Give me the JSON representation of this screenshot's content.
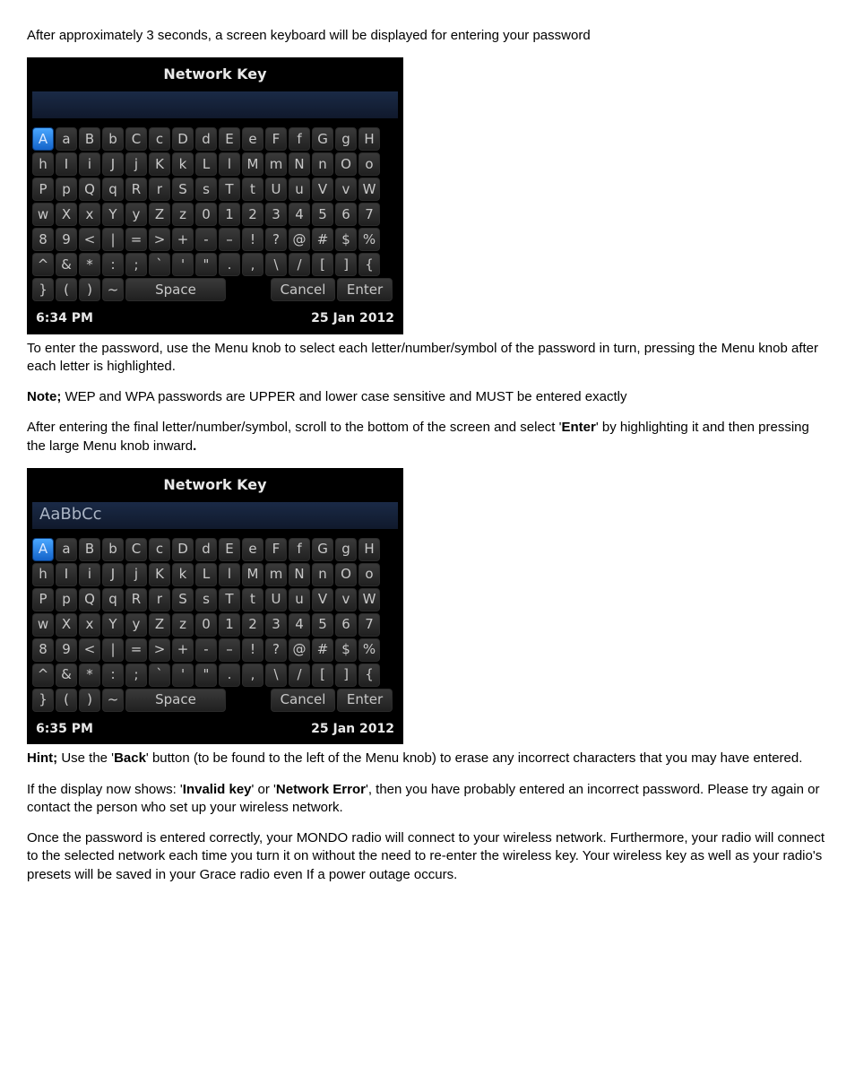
{
  "para1": "After approximately 3 seconds, a screen keyboard will be displayed for entering your password",
  "kbd_title": "Network Key",
  "kbd1_typed": "",
  "kbd2_typed": "AaBbCc",
  "keys_row1": [
    "A",
    "a",
    "B",
    "b",
    "C",
    "c",
    "D",
    "d",
    "E",
    "e",
    "F",
    "f",
    "G",
    "g",
    "H"
  ],
  "keys_row2": [
    "h",
    "I",
    "i",
    "J",
    "j",
    "K",
    "k",
    "L",
    "l",
    "M",
    "m",
    "N",
    "n",
    "O",
    "o"
  ],
  "keys_row3": [
    "P",
    "p",
    "Q",
    "q",
    "R",
    "r",
    "S",
    "s",
    "T",
    "t",
    "U",
    "u",
    "V",
    "v",
    "W"
  ],
  "keys_row4": [
    "w",
    "X",
    "x",
    "Y",
    "y",
    "Z",
    "z",
    "0",
    "1",
    "2",
    "3",
    "4",
    "5",
    "6",
    "7"
  ],
  "keys_row5": [
    "8",
    "9",
    "<",
    "|",
    "=",
    ">",
    "+",
    "-",
    "–",
    "!",
    "?",
    "@",
    "#",
    "$",
    "%"
  ],
  "keys_row6": [
    "^",
    "&",
    "*",
    ":",
    ";",
    "`",
    "'",
    "\"",
    ".",
    ",",
    "\\",
    "/",
    "[",
    "]",
    "{"
  ],
  "keys_row7": [
    "}",
    "(",
    ")",
    "~"
  ],
  "key_space": "Space",
  "key_cancel": "Cancel",
  "key_enter": "Enter",
  "status1_time": "6:34 PM",
  "status1_date": "25 Jan 2012",
  "status2_time": "6:35 PM",
  "status2_date": "25 Jan 2012",
  "para2": "To enter the password, use the Menu knob to select each letter/number/symbol of the password in turn, pressing the Menu knob after each letter is highlighted.",
  "para3_label": "Note;",
  "para3_body": "  WEP and WPA passwords are UPPER and lower case sensitive and MUST be entered exactly",
  "para4_a": "After entering the final letter/number/symbol, scroll to the bottom of the screen and select '",
  "para4_enter": "Enter",
  "para4_b": "' by highlighting it and then pressing the large Menu knob inward",
  "para4_dot": ".",
  "para5_label": "Hint;",
  "para5_a": "  Use the '",
  "para5_back": "Back",
  "para5_b": "' button (to be found to the left of the Menu knob) to erase any incorrect characters that you may have entered.",
  "para6_a": "If the display now shows: '",
  "para6_ik": "Invalid key",
  "para6_b": "' or '",
  "para6_ne": "Network Error",
  "para6_c": "', then you have probably entered an incorrect password. Please try again or contact the person who set up your wireless network.",
  "para7": "Once the password is entered correctly, your MONDO radio will connect to your wireless network. Furthermore, your radio will connect to the selected network each time you turn it on without the need to re-enter the wireless key.  Your wireless key as well as your radio's presets will be saved in your Grace radio even If a power outage occurs."
}
